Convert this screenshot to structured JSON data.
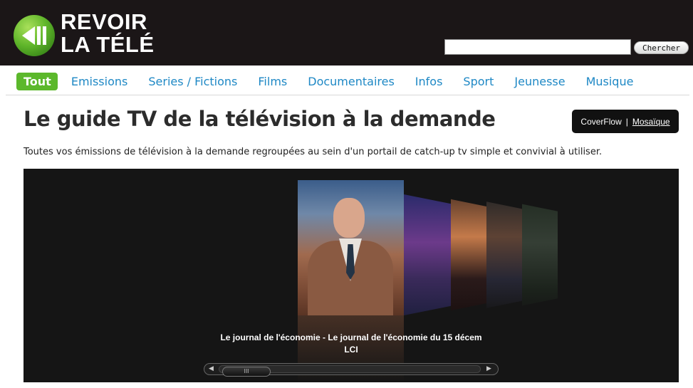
{
  "header": {
    "logo_line1": "REVOIR",
    "logo_line2": "LA TÉLÉ",
    "logo_icon": "rewind-play-icon",
    "search": {
      "value": "",
      "placeholder": "",
      "button_label": "Chercher"
    }
  },
  "nav": {
    "items": [
      {
        "label": "Tout",
        "active": true
      },
      {
        "label": "Emissions"
      },
      {
        "label": "Series / Fictions"
      },
      {
        "label": "Films"
      },
      {
        "label": "Documentaires"
      },
      {
        "label": "Infos"
      },
      {
        "label": "Sport"
      },
      {
        "label": "Jeunesse"
      },
      {
        "label": "Musique"
      }
    ]
  },
  "main": {
    "title": "Le guide TV de la télévision à la demande",
    "intro": "Toutes vos émissions de télévision à la demande regroupées au sein d'un portail de catch-up tv simple et convivial à utiliser.",
    "view_switch": {
      "current": "CoverFlow",
      "separator": "|",
      "other": "Mosaïque"
    }
  },
  "coverflow": {
    "caption_title": "Le journal de l'économie - Le journal de l'économie du 15 décem",
    "caption_channel": "LCI",
    "scroll_left_icon": "arrow-left-icon",
    "scroll_right_icon": "arrow-right-icon",
    "thumb_grip": "III"
  },
  "colors": {
    "header_bg": "#1b1617",
    "nav_link": "#1e88c5",
    "nav_active_bg": "#5cb82c",
    "coverflow_bg": "#151515"
  }
}
